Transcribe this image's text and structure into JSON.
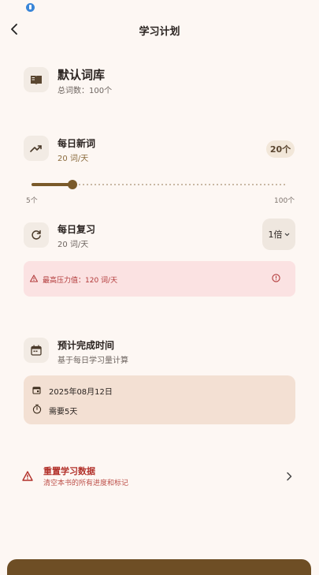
{
  "header": {
    "title": "学习计划"
  },
  "book": {
    "name": "默认词库",
    "total": "总词数：100个"
  },
  "new_words": {
    "label": "每日新词",
    "rate": "20 词/天",
    "count": "20个",
    "slider_min": "5个",
    "slider_max": "100个",
    "slider_fraction": 0.16
  },
  "review": {
    "label": "每日复习",
    "rate": "20 词/天",
    "multiplier": "1倍"
  },
  "warning": {
    "text": "最高压力值：120 词/天"
  },
  "estimate": {
    "label": "预计完成时间",
    "sub": "基于每日学习量计算",
    "date": "2025年08月12日",
    "duration": "需要5天"
  },
  "reset": {
    "title": "重置学习数据",
    "sub": "清空本书的所有进度和标记"
  },
  "icons": {
    "back": "chevron-left-icon",
    "book": "book-icon",
    "trend": "trending-up-icon",
    "refresh": "refresh-icon",
    "warning": "warning-icon",
    "info": "info-icon",
    "calendar": "calendar-icon",
    "timer": "timer-icon",
    "chevron_right": "chevron-right-icon"
  },
  "colors": {
    "accent": "#7a5a2a",
    "danger": "#b2312a",
    "background": "#fdf7f3"
  }
}
